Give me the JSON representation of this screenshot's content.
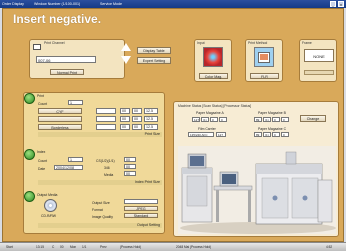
{
  "window": {
    "tabs": [
      "Order Display",
      "Window Number (1/100-001)",
      "Service Mode"
    ],
    "min_label": "_",
    "close_label": "x"
  },
  "page_title": "Insert negative.",
  "print_channel": {
    "header": "Print Channel",
    "value": "007-06",
    "button": "Normal Print",
    "display_table": "Display Table",
    "expert_setting": "Expert Setting"
  },
  "input_panel": {
    "header": "Input",
    "button": "Color Mag."
  },
  "print_method": {
    "header": "Print Method",
    "button": "FLR"
  },
  "frame_panel": {
    "header": "Frame",
    "value": "NONE"
  },
  "print_section": {
    "label": "Print",
    "count_label": "Count",
    "count_value": "1",
    "rows": [
      {
        "left": "CYF",
        "c1": "00",
        "c2": "00",
        "c3": "12.5"
      },
      {
        "left": "",
        "c1": "00",
        "c2": "00",
        "c3": "12.5"
      },
      {
        "left": "Borderless",
        "c1": "00",
        "c2": "00",
        "c3": "12.5"
      }
    ],
    "size": "Print Size"
  },
  "index_section": {
    "label": "Index",
    "count_label": "Count",
    "count_value": "1",
    "date_label": "Date",
    "date_value": "2004/12/08",
    "rows": [
      {
        "label": "CS(1/2)(1/1)",
        "c1": "00"
      },
      {
        "label": "346",
        "c1": "00"
      },
      {
        "label": "Media",
        "c1": "00"
      }
    ],
    "size": "Index Print Size"
  },
  "output_section": {
    "label": "Output Media",
    "disc": "CD-R/RW",
    "rows": [
      {
        "label": "Output Size",
        "value": ""
      },
      {
        "label": "Format",
        "value": "JPEG"
      },
      {
        "label": "Image Quality",
        "value": "Standard"
      }
    ],
    "setting": "Output Setting"
  },
  "machine_status": {
    "title": "Machine Status [Scan Status] [Processor Status]",
    "mag_a": {
      "label": "Paper Magazine A",
      "vals": [
        "127",
        "(1)",
        "0",
        "0"
      ]
    },
    "mag_b": {
      "label": "Paper Magazine B",
      "vals": [
        "89",
        "(1)",
        "0",
        "0"
      ]
    },
    "change": "Change",
    "film_carrier": {
      "label": "Film Carrier",
      "value": "135/240 AFC",
      "ext": "127"
    },
    "mag_c": {
      "label": "Paper Magazine C",
      "vals": [
        "89",
        "(1)",
        "0",
        "0"
      ]
    }
  },
  "taskbar": {
    "items": [
      "Start",
      "13:15",
      "C",
      "00",
      "Mon",
      "1/1",
      "Prev",
      "(Process Hold)",
      "2048 Mai (Process Hold)"
    ],
    "right": "4:52"
  },
  "colors": {
    "accent": "#d9a95a",
    "panel": "#f3e4c0",
    "status_green": "#2f8a22",
    "titlebar": "#1f4594"
  }
}
